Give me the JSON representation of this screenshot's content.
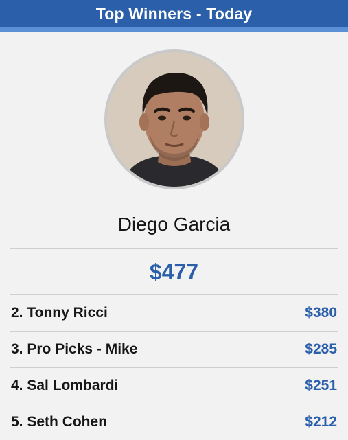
{
  "header": {
    "title": "Top Winners - Today"
  },
  "winner": {
    "name": "Diego Garcia",
    "amount": "$477",
    "avatar_icon": "person-portrait"
  },
  "others": [
    {
      "label": "2. Tonny Ricci",
      "amount": "$380"
    },
    {
      "label": "3. Pro Picks - Mike",
      "amount": "$285"
    },
    {
      "label": "4. Sal Lombardi",
      "amount": "$251"
    },
    {
      "label": "5. Seth Cohen",
      "amount": "$212"
    }
  ],
  "colors": {
    "header_bg": "#2b5fa9",
    "header_accent": "#5b8fd6",
    "amount": "#2b5fa9",
    "background": "#f2f2f2"
  }
}
